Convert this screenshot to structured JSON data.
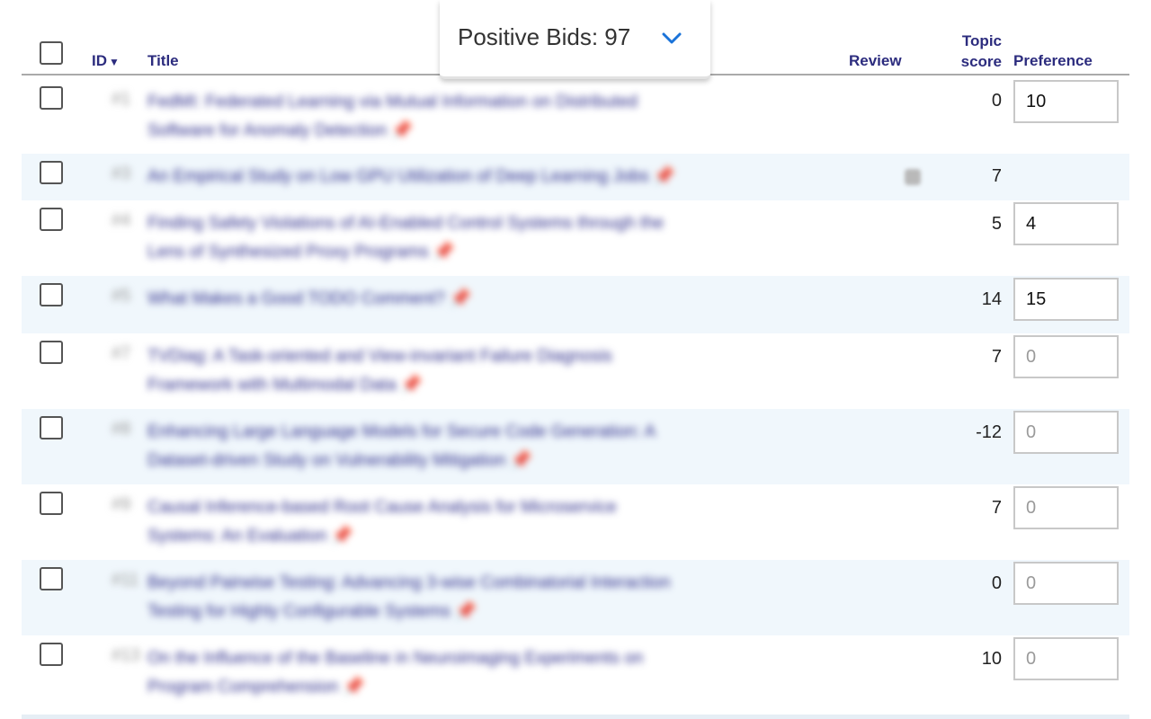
{
  "header": {
    "id_label": "ID",
    "sort_indicator": "▼",
    "title_label": "Title",
    "review_label": "Review",
    "topic_score_line1": "Topic",
    "topic_score_line2": "score",
    "preference_label": "Preference"
  },
  "bids_panel": {
    "label": "Positive Bids: 97",
    "chevron_icon": "chevron-down-icon"
  },
  "rows": [
    {
      "id": "#1",
      "title_lines": [
        "FedMI: Federated Learning via Mutual Information on Distributed",
        "Software for Anomaly Detection"
      ],
      "score": "0",
      "preference": "10",
      "pref_placeholder": false
    },
    {
      "id": "#3",
      "title_lines": [
        "An Empirical Study on Low GPU Utilization of Deep Learning Jobs"
      ],
      "score": "7",
      "preference": "",
      "no_input": true,
      "review_mark": true
    },
    {
      "id": "#4",
      "title_lines": [
        "Finding Safety Violations of AI-Enabled Control Systems through the",
        "Lens of Synthesized Proxy Programs"
      ],
      "score": "5",
      "preference": "4",
      "pref_placeholder": false
    },
    {
      "id": "#5",
      "title_lines": [
        "What Makes a Good TODO Comment?"
      ],
      "score": "14",
      "preference": "15",
      "pref_placeholder": false
    },
    {
      "id": "#7",
      "title_lines": [
        "TVDiag: A Task-oriented and View-invariant Failure Diagnosis",
        "Framework with Multimodal Data"
      ],
      "score": "7",
      "preference": "0",
      "pref_placeholder": true
    },
    {
      "id": "#8",
      "title_lines": [
        "Enhancing Large Language Models for Secure Code Generation: A",
        "Dataset-driven Study on Vulnerability Mitigation"
      ],
      "score": "-12",
      "preference": "0",
      "pref_placeholder": true
    },
    {
      "id": "#9",
      "title_lines": [
        "Causal Inference-based Root Cause Analysis for Microservice",
        "Systems: An Evaluation"
      ],
      "score": "7",
      "preference": "0",
      "pref_placeholder": true
    },
    {
      "id": "#11",
      "title_lines": [
        "Beyond Pairwise Testing: Advancing 3-wise Combinatorial Interaction",
        "Testing for Highly Configurable Systems"
      ],
      "score": "0",
      "preference": "0",
      "pref_placeholder": true
    },
    {
      "id": "#13",
      "title_lines": [
        "On the Influence of the Baseline in Neuroimaging Experiments on",
        "Program Comprehension"
      ],
      "score": "10",
      "preference": "0",
      "pref_placeholder": true
    }
  ]
}
